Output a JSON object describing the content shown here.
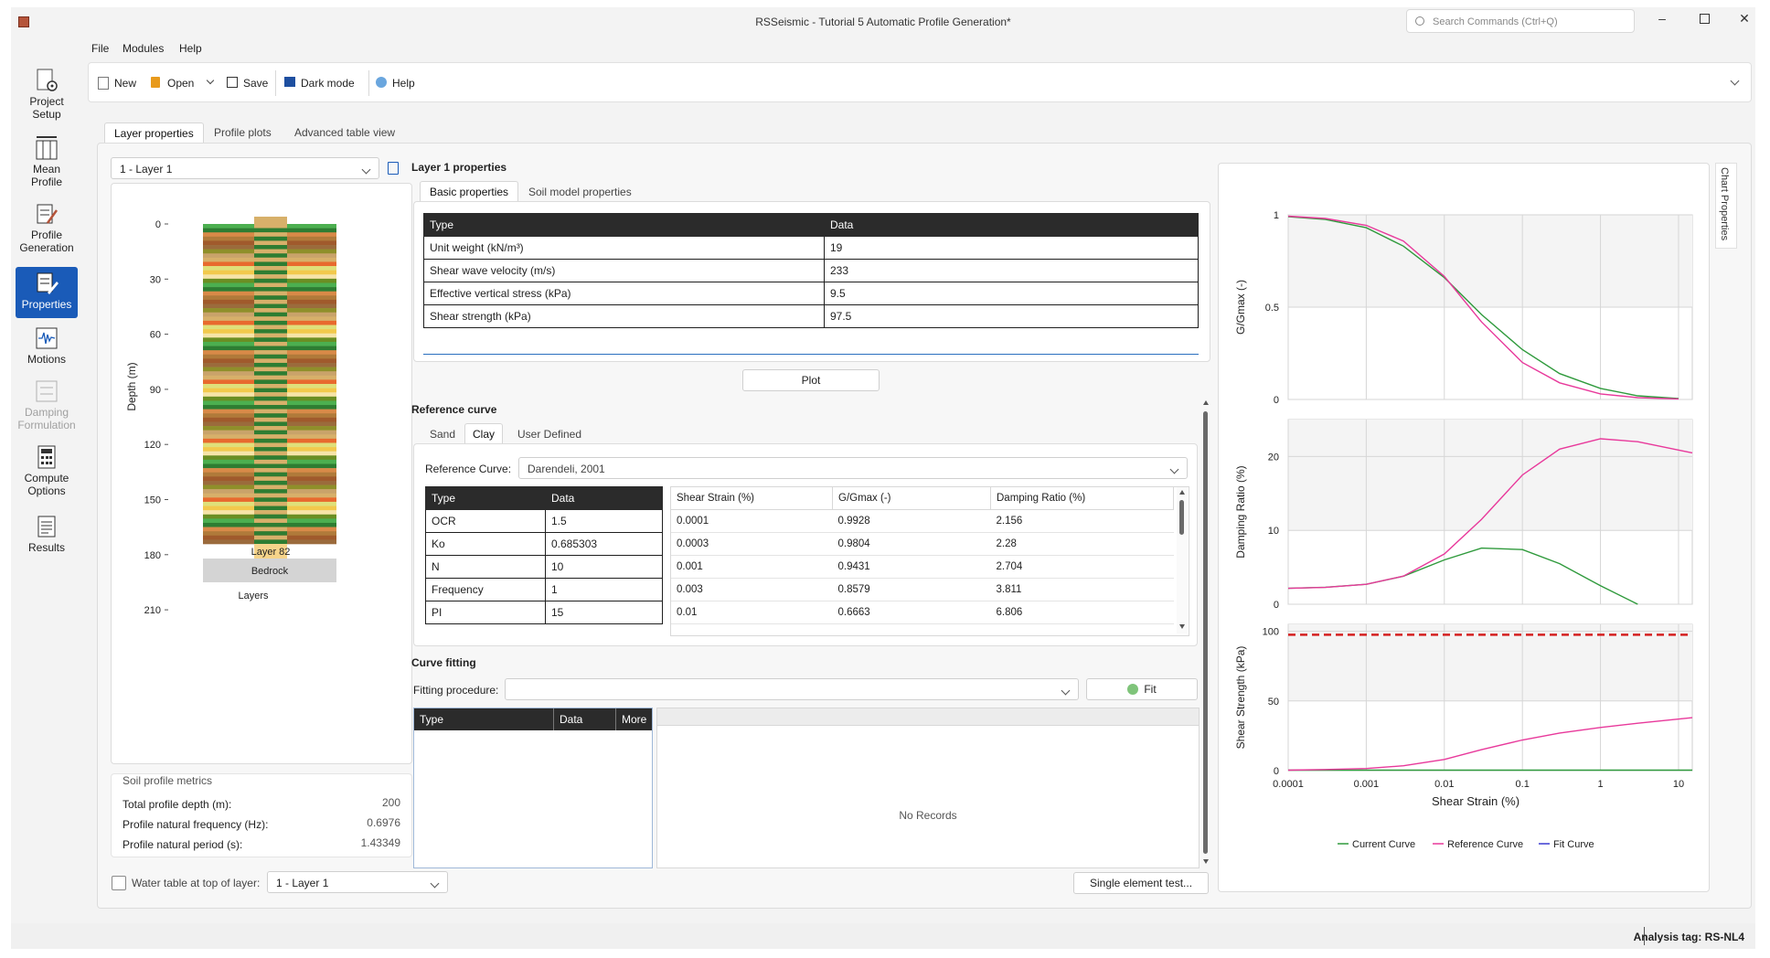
{
  "window": {
    "title": "RSSeismic - Tutorial 5 Automatic Profile Generation*",
    "search_placeholder": "Search Commands (Ctrl+Q)"
  },
  "menu": [
    "File",
    "Modules",
    "Help"
  ],
  "toolbar": {
    "new": "New",
    "open": "Open",
    "save": "Save",
    "dark_mode": "Dark mode",
    "help": "Help"
  },
  "sidebar": [
    {
      "l1": "Project",
      "l2": "Setup",
      "state": "normal"
    },
    {
      "l1": "Mean",
      "l2": "Profile",
      "state": "normal"
    },
    {
      "l1": "Profile",
      "l2": "Generation",
      "state": "normal"
    },
    {
      "l1": "Properties",
      "l2": "",
      "state": "active"
    },
    {
      "l1": "Motions",
      "l2": "",
      "state": "normal"
    },
    {
      "l1": "Damping",
      "l2": "Formulation",
      "state": "disabled"
    },
    {
      "l1": "Compute",
      "l2": "Options",
      "state": "normal"
    },
    {
      "l1": "Results",
      "l2": "",
      "state": "normal"
    }
  ],
  "tabs": [
    "Layer properties",
    "Profile plots",
    "Advanced table view"
  ],
  "layer_select": "1 - Layer 1",
  "profile": {
    "y_ticks": [
      "0",
      "30",
      "60",
      "90",
      "120",
      "150",
      "180",
      "210"
    ],
    "ylabel": "Depth (m)",
    "xlabel": "Layers",
    "bottom_layer_label": "Layer 82",
    "bedrock_label": "Bedrock"
  },
  "metrics": {
    "title": "Soil profile metrics",
    "rows": [
      {
        "label": "Total profile depth (m):",
        "value": "200"
      },
      {
        "label": "Profile natural frequency (Hz):",
        "value": "0.6976"
      },
      {
        "label": "Profile natural period (s):",
        "value": "1.43349"
      }
    ]
  },
  "water_table": {
    "label": "Water table at top of layer:",
    "value": "1 - Layer 1"
  },
  "layer_props": {
    "title": "Layer 1 properties",
    "subtabs": [
      "Basic properties",
      "Soil model properties"
    ],
    "headers": [
      "Type",
      "Data"
    ],
    "rows": [
      {
        "type": "Unit weight (kN/m³)",
        "data": "19"
      },
      {
        "type": "Shear wave velocity (m/s)",
        "data": "233"
      },
      {
        "type": "Effective vertical stress (kPa)",
        "data": "9.5"
      },
      {
        "type": "Shear strength (kPa)",
        "data": "97.5"
      }
    ],
    "plot_button": "Plot"
  },
  "reference_curve": {
    "title": "Reference curve",
    "subtabs": [
      "Sand",
      "Clay",
      "User Defined"
    ],
    "curve_label": "Reference Curve:",
    "curve_value": "Darendeli, 2001",
    "param_headers": [
      "Type",
      "Data"
    ],
    "params": [
      {
        "type": "OCR",
        "data": "1.5"
      },
      {
        "type": "Ko",
        "data": "0.685303"
      },
      {
        "type": "N",
        "data": "10"
      },
      {
        "type": "Frequency",
        "data": "1"
      },
      {
        "type": "PI",
        "data": "15"
      }
    ],
    "curve_headers": [
      "Shear Strain (%)",
      "G/Gmax (-)",
      "Damping Ratio (%)"
    ],
    "curve_rows": [
      [
        "0.0001",
        "0.9928",
        "2.156"
      ],
      [
        "0.0003",
        "0.9804",
        "2.28"
      ],
      [
        "0.001",
        "0.9431",
        "2.704"
      ],
      [
        "0.003",
        "0.8579",
        "3.811"
      ],
      [
        "0.01",
        "0.6663",
        "6.806"
      ]
    ]
  },
  "curve_fitting": {
    "title": "Curve fitting",
    "procedure_label": "Fitting procedure:",
    "procedure_value": "",
    "fit_button": "Fit",
    "headers": [
      "Type",
      "Data",
      "More"
    ],
    "no_records": "No Records",
    "single_element_button": "Single element test..."
  },
  "chart_properties_label": "Chart Properties",
  "chart_data": {
    "type": "line",
    "xlabel": "Shear Strain (%)",
    "x_ticks": [
      "0.0001",
      "0.001",
      "0.01",
      "0.1",
      "1",
      "10"
    ],
    "x_log": true,
    "xlim": [
      0.0001,
      15
    ],
    "legend": [
      "Current Curve",
      "Reference Curve",
      "Fit Curve"
    ],
    "legend_placement": "bottom",
    "colors": {
      "current": "#2f9a3c",
      "reference": "#e8399b",
      "fit": "#3b3bd0",
      "strength_line": "#d42020"
    },
    "panels": [
      {
        "ylabel": "G/Gmax (-)",
        "ylim": [
          0,
          1
        ],
        "y_ticks": [
          "0",
          "0.5",
          "1"
        ],
        "series": [
          {
            "name": "Current Curve",
            "x": [
              0.0001,
              0.0003,
              0.001,
              0.003,
              0.01,
              0.03,
              0.1,
              0.3,
              1,
              3,
              10
            ],
            "y": [
              0.99,
              0.975,
              0.93,
              0.83,
              0.66,
              0.46,
              0.27,
              0.14,
              0.06,
              0.02,
              0.005
            ]
          },
          {
            "name": "Reference Curve",
            "x": [
              0.0001,
              0.0003,
              0.001,
              0.003,
              0.01,
              0.03,
              0.1,
              0.3,
              1,
              3,
              10
            ],
            "y": [
              0.9928,
              0.9804,
              0.9431,
              0.8579,
              0.6663,
              0.42,
              0.2,
              0.09,
              0.03,
              0.01,
              0.003
            ]
          }
        ]
      },
      {
        "ylabel": "Damping Ratio (%)",
        "ylim": [
          0,
          25
        ],
        "y_ticks": [
          "0",
          "10",
          "20"
        ],
        "series": [
          {
            "name": "Current Curve",
            "x": [
              0.0001,
              0.0003,
              0.001,
              0.003,
              0.01,
              0.03,
              0.1,
              0.3,
              1,
              3
            ],
            "y": [
              2.15,
              2.3,
              2.7,
              3.8,
              6.0,
              7.6,
              7.4,
              5.5,
              2.5,
              0
            ]
          },
          {
            "name": "Reference Curve",
            "x": [
              0.0001,
              0.0003,
              0.001,
              0.003,
              0.01,
              0.03,
              0.1,
              0.3,
              1,
              3,
              15
            ],
            "y": [
              2.156,
              2.28,
              2.704,
              3.811,
              6.806,
              11.5,
              17.5,
              21,
              22.4,
              22,
              20.5
            ]
          }
        ]
      },
      {
        "ylabel": "Shear Strength (kPa)",
        "ylim": [
          0,
          105
        ],
        "y_ticks": [
          "0",
          "50",
          "100"
        ],
        "hline": 97.5,
        "series": [
          {
            "name": "Current Curve",
            "x": [
              0.0001,
              15
            ],
            "y": [
              0.3,
              0.3
            ]
          },
          {
            "name": "Reference Curve",
            "x": [
              0.0001,
              0.0003,
              0.001,
              0.003,
              0.01,
              0.03,
              0.1,
              0.3,
              1,
              3,
              15
            ],
            "y": [
              0.3,
              0.8,
              1.5,
              3.5,
              8,
              15,
              22,
              27,
              31,
              34,
              38
            ]
          }
        ]
      }
    ]
  },
  "status": {
    "analysis_tag": "Analysis tag: RS-NL4"
  }
}
